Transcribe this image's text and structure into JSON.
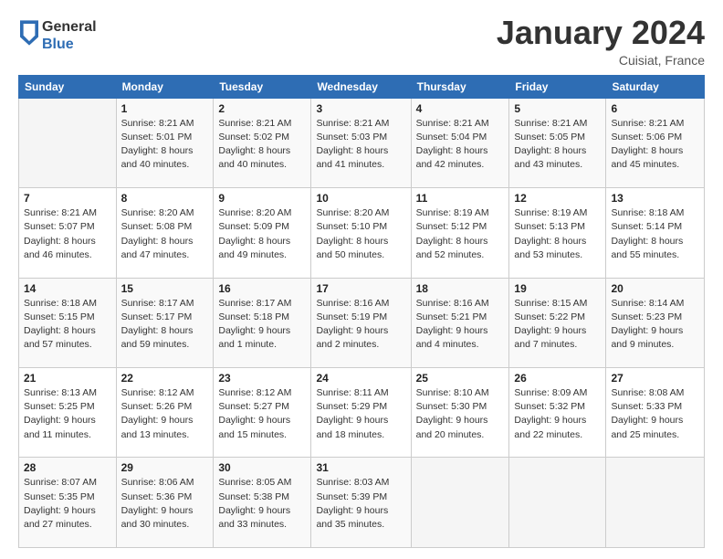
{
  "header": {
    "logo_line1": "General",
    "logo_line2": "Blue",
    "title": "January 2024",
    "subtitle": "Cuisiat, France"
  },
  "weekdays": [
    "Sunday",
    "Monday",
    "Tuesday",
    "Wednesday",
    "Thursday",
    "Friday",
    "Saturday"
  ],
  "weeks": [
    [
      {
        "day": "",
        "info": ""
      },
      {
        "day": "1",
        "info": "Sunrise: 8:21 AM\nSunset: 5:01 PM\nDaylight: 8 hours\nand 40 minutes."
      },
      {
        "day": "2",
        "info": "Sunrise: 8:21 AM\nSunset: 5:02 PM\nDaylight: 8 hours\nand 40 minutes."
      },
      {
        "day": "3",
        "info": "Sunrise: 8:21 AM\nSunset: 5:03 PM\nDaylight: 8 hours\nand 41 minutes."
      },
      {
        "day": "4",
        "info": "Sunrise: 8:21 AM\nSunset: 5:04 PM\nDaylight: 8 hours\nand 42 minutes."
      },
      {
        "day": "5",
        "info": "Sunrise: 8:21 AM\nSunset: 5:05 PM\nDaylight: 8 hours\nand 43 minutes."
      },
      {
        "day": "6",
        "info": "Sunrise: 8:21 AM\nSunset: 5:06 PM\nDaylight: 8 hours\nand 45 minutes."
      }
    ],
    [
      {
        "day": "7",
        "info": "Sunrise: 8:21 AM\nSunset: 5:07 PM\nDaylight: 8 hours\nand 46 minutes."
      },
      {
        "day": "8",
        "info": "Sunrise: 8:20 AM\nSunset: 5:08 PM\nDaylight: 8 hours\nand 47 minutes."
      },
      {
        "day": "9",
        "info": "Sunrise: 8:20 AM\nSunset: 5:09 PM\nDaylight: 8 hours\nand 49 minutes."
      },
      {
        "day": "10",
        "info": "Sunrise: 8:20 AM\nSunset: 5:10 PM\nDaylight: 8 hours\nand 50 minutes."
      },
      {
        "day": "11",
        "info": "Sunrise: 8:19 AM\nSunset: 5:12 PM\nDaylight: 8 hours\nand 52 minutes."
      },
      {
        "day": "12",
        "info": "Sunrise: 8:19 AM\nSunset: 5:13 PM\nDaylight: 8 hours\nand 53 minutes."
      },
      {
        "day": "13",
        "info": "Sunrise: 8:18 AM\nSunset: 5:14 PM\nDaylight: 8 hours\nand 55 minutes."
      }
    ],
    [
      {
        "day": "14",
        "info": "Sunrise: 8:18 AM\nSunset: 5:15 PM\nDaylight: 8 hours\nand 57 minutes."
      },
      {
        "day": "15",
        "info": "Sunrise: 8:17 AM\nSunset: 5:17 PM\nDaylight: 8 hours\nand 59 minutes."
      },
      {
        "day": "16",
        "info": "Sunrise: 8:17 AM\nSunset: 5:18 PM\nDaylight: 9 hours\nand 1 minute."
      },
      {
        "day": "17",
        "info": "Sunrise: 8:16 AM\nSunset: 5:19 PM\nDaylight: 9 hours\nand 2 minutes."
      },
      {
        "day": "18",
        "info": "Sunrise: 8:16 AM\nSunset: 5:21 PM\nDaylight: 9 hours\nand 4 minutes."
      },
      {
        "day": "19",
        "info": "Sunrise: 8:15 AM\nSunset: 5:22 PM\nDaylight: 9 hours\nand 7 minutes."
      },
      {
        "day": "20",
        "info": "Sunrise: 8:14 AM\nSunset: 5:23 PM\nDaylight: 9 hours\nand 9 minutes."
      }
    ],
    [
      {
        "day": "21",
        "info": "Sunrise: 8:13 AM\nSunset: 5:25 PM\nDaylight: 9 hours\nand 11 minutes."
      },
      {
        "day": "22",
        "info": "Sunrise: 8:12 AM\nSunset: 5:26 PM\nDaylight: 9 hours\nand 13 minutes."
      },
      {
        "day": "23",
        "info": "Sunrise: 8:12 AM\nSunset: 5:27 PM\nDaylight: 9 hours\nand 15 minutes."
      },
      {
        "day": "24",
        "info": "Sunrise: 8:11 AM\nSunset: 5:29 PM\nDaylight: 9 hours\nand 18 minutes."
      },
      {
        "day": "25",
        "info": "Sunrise: 8:10 AM\nSunset: 5:30 PM\nDaylight: 9 hours\nand 20 minutes."
      },
      {
        "day": "26",
        "info": "Sunrise: 8:09 AM\nSunset: 5:32 PM\nDaylight: 9 hours\nand 22 minutes."
      },
      {
        "day": "27",
        "info": "Sunrise: 8:08 AM\nSunset: 5:33 PM\nDaylight: 9 hours\nand 25 minutes."
      }
    ],
    [
      {
        "day": "28",
        "info": "Sunrise: 8:07 AM\nSunset: 5:35 PM\nDaylight: 9 hours\nand 27 minutes."
      },
      {
        "day": "29",
        "info": "Sunrise: 8:06 AM\nSunset: 5:36 PM\nDaylight: 9 hours\nand 30 minutes."
      },
      {
        "day": "30",
        "info": "Sunrise: 8:05 AM\nSunset: 5:38 PM\nDaylight: 9 hours\nand 33 minutes."
      },
      {
        "day": "31",
        "info": "Sunrise: 8:03 AM\nSunset: 5:39 PM\nDaylight: 9 hours\nand 35 minutes."
      },
      {
        "day": "",
        "info": ""
      },
      {
        "day": "",
        "info": ""
      },
      {
        "day": "",
        "info": ""
      }
    ]
  ]
}
